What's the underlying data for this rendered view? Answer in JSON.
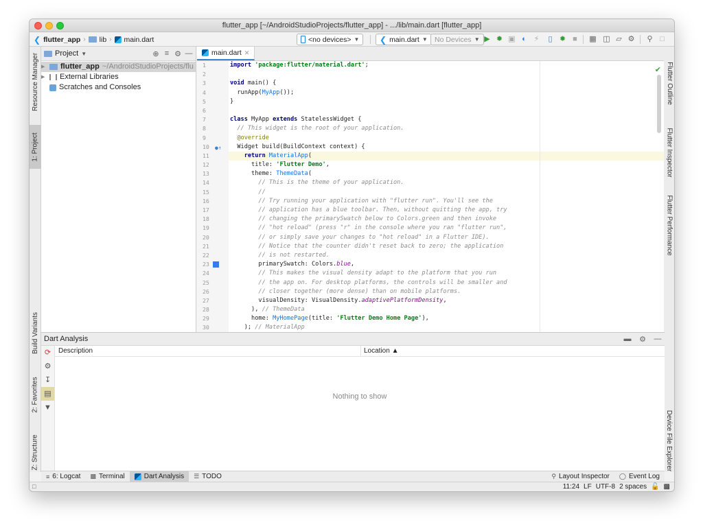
{
  "window": {
    "title": "flutter_app [~/AndroidStudioProjects/flutter_app] - .../lib/main.dart [flutter_app]"
  },
  "breadcrumbs": [
    "flutter_app",
    "lib",
    "main.dart"
  ],
  "toolbar": {
    "device_selector": "<no devices>",
    "run_config": "main.dart",
    "device_dropdown": "No Devices"
  },
  "left_tabs": {
    "resource_manager": "Resource Manager",
    "project": "1: Project",
    "build_variants": "Build Variants",
    "favorites": "2: Favorites",
    "structure": "Z: Structure"
  },
  "right_tabs": {
    "flutter_outline": "Flutter Outline",
    "flutter_inspector": "Flutter Inspector",
    "flutter_performance": "Flutter Performance",
    "device_file_explorer": "Device File Explorer"
  },
  "project_panel": {
    "title": "Project",
    "root_name": "flutter_app",
    "root_path": "~/AndroidStudioProjects/flu",
    "external_libraries": "External Libraries",
    "scratches": "Scratches and Consoles"
  },
  "editor": {
    "tab_label": "main.dart",
    "line_numbers": [
      "1",
      "2",
      "3",
      "4",
      "5",
      "6",
      "7",
      "8",
      "9",
      "10",
      "11",
      "12",
      "13",
      "14",
      "15",
      "16",
      "17",
      "18",
      "19",
      "20",
      "21",
      "22",
      "23",
      "24",
      "25",
      "26",
      "27",
      "28",
      "29",
      "30"
    ],
    "code": {
      "l1_kw": "import ",
      "l1_str": "'package:flutter/material.dart'",
      "l1_end": ";",
      "l3_kw": "void ",
      "l3_rest": "main() {",
      "l4_a": "  runApp(",
      "l4_fn": "MyApp",
      "l4_b": "());",
      "l5": "}",
      "l7_kw1": "class ",
      "l7_a": "MyApp ",
      "l7_kw2": "extends ",
      "l7_b": "StatelessWidget {",
      "l8": "  // This widget is the root of your application.",
      "l9": "  @override",
      "l10": "  Widget build(BuildContext context) {",
      "l11_pre": "    ",
      "l11_kw": "return ",
      "l11_fn": "MaterialApp",
      "l11_end": "(",
      "l12_a": "      title: ",
      "l12_str": "'Flutter Demo'",
      "l12_b": ",",
      "l13_a": "      theme: ",
      "l13_fn": "ThemeData",
      "l13_b": "(",
      "l14": "        // This is the theme of your application.",
      "l15": "        //",
      "l16": "        // Try running your application with \"flutter run\". You'll see the",
      "l17": "        // application has a blue toolbar. Then, without quitting the app, try",
      "l18": "        // changing the primarySwatch below to Colors.green and then invoke",
      "l19": "        // \"hot reload\" (press \"r\" in the console where you ran \"flutter run\",",
      "l20": "        // or simply save your changes to \"hot reload\" in a Flutter IDE).",
      "l21": "        // Notice that the counter didn't reset back to zero; the application",
      "l22": "        // is not restarted.",
      "l23_a": "        primarySwatch: Colors.",
      "l23_it": "blue",
      "l23_b": ",",
      "l24": "        // This makes the visual density adapt to the platform that you run",
      "l25": "        // the app on. For desktop platforms, the controls will be smaller and",
      "l26": "        // closer together (more dense) than on mobile platforms.",
      "l27_a": "        visualDensity: VisualDensity.",
      "l27_it": "adaptivePlatformDensity",
      "l27_b": ",",
      "l28_a": "      ), ",
      "l28_cmt": "// ThemeData",
      "l29_a": "      home: ",
      "l29_fn": "MyHomePage",
      "l29_b": "(title: ",
      "l29_str": "'Flutter Demo Home Page'",
      "l29_c": "),",
      "l30_a": "    ); ",
      "l30_cmt": "// MaterialApp"
    }
  },
  "analysis": {
    "title": "Dart Analysis",
    "col_description": "Description",
    "col_location": "Location ▲",
    "empty_text": "Nothing to show"
  },
  "bottom_tabs": {
    "logcat": "6: Logcat",
    "terminal": "Terminal",
    "dart_analysis": "Dart Analysis",
    "todo": "TODO",
    "layout_inspector": "Layout Inspector",
    "event_log": "Event Log"
  },
  "status": {
    "position": "11:24",
    "line_sep": "LF",
    "encoding": "UTF-8",
    "indent": "2 spaces"
  }
}
